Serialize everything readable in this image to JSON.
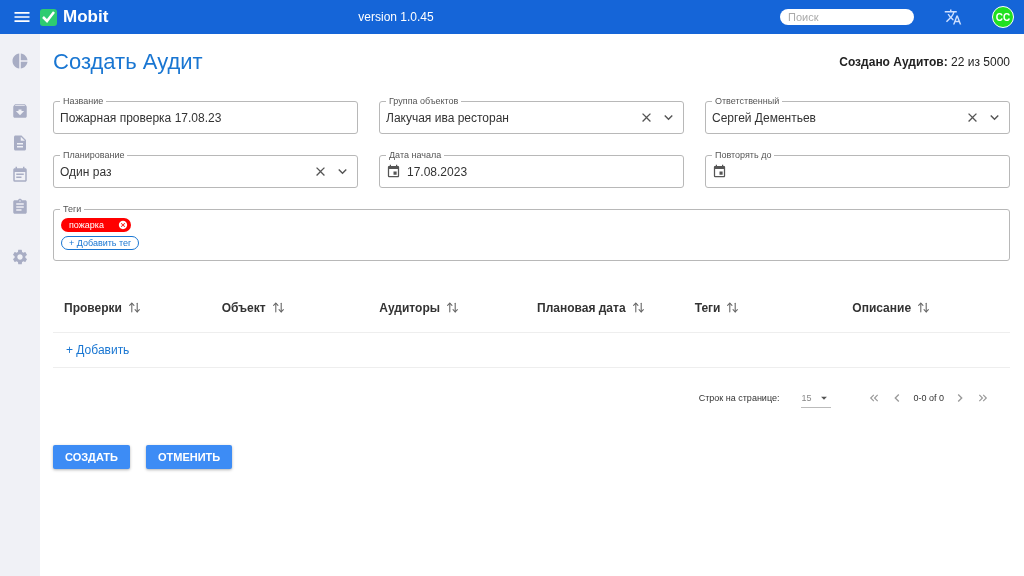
{
  "header": {
    "app_name": "Mobit",
    "version": "version 1.0.45",
    "search": {
      "placeholder": "Поиск"
    },
    "avatar": "CC"
  },
  "sidebar": {
    "items": [
      {
        "kind": "dashboard",
        "selected": false
      },
      {
        "kind": "archive",
        "selected": false
      },
      {
        "kind": "documents",
        "selected": false
      },
      {
        "kind": "calendar",
        "selected": false
      },
      {
        "kind": "audits",
        "selected": false
      },
      {
        "kind": "settings",
        "selected": false
      }
    ]
  },
  "page": {
    "title": "Создать Аудит",
    "counter": "**Создано Аудитов:** 22 из 5000"
  },
  "fields": [
    {
      "kind": "text",
      "label": "Название",
      "value": "Пожарная проверка 17.08.23"
    },
    {
      "kind": "select",
      "label": "Группа объектов",
      "value": "Лакучая ива ресторан"
    },
    {
      "kind": "select",
      "label": "Ответственный",
      "value": "Сергей Дементьев"
    },
    {
      "kind": "select",
      "label": "Планирование",
      "value": "Один раз"
    },
    {
      "kind": "date",
      "label": "Дата начала",
      "value": "17.08.2023"
    },
    {
      "kind": "date",
      "label": "Повторять до"
    }
  ],
  "tags": {
    "label": "Теги",
    "items": [
      {
        "label": "пожарка",
        "color": "#ff0000"
      }
    ],
    "add_button": "+ Добавить тег"
  },
  "table": {
    "columns": [
      "Проверки",
      "Объект",
      "Аудиторы",
      "Плановая дата",
      "Теги",
      "Описание"
    ],
    "add_link": "+ Добавить"
  },
  "pagination": {
    "rows_label": "Строк на странице:",
    "rows_value": "15",
    "range": "0-0 of 0"
  },
  "buttons": [
    "СОЗДАТЬ",
    "ОТМЕНИТЬ"
  ]
}
